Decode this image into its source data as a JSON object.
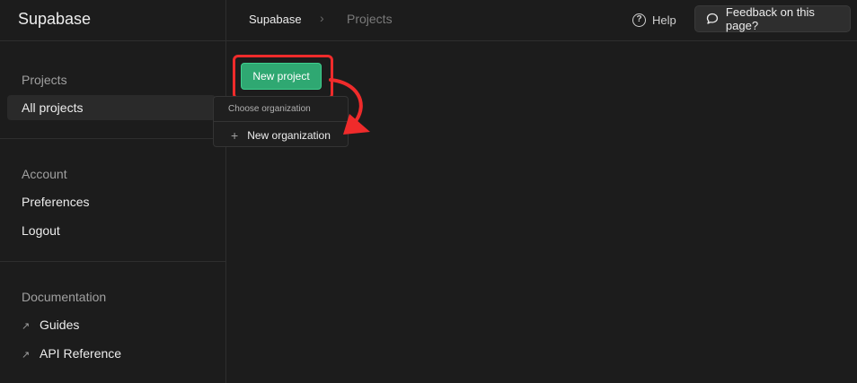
{
  "sidebar": {
    "brand": "Supabase",
    "sections": [
      {
        "title": "Projects",
        "items": [
          {
            "label": "All projects"
          }
        ]
      },
      {
        "title": "Account",
        "items": [
          {
            "label": "Preferences"
          },
          {
            "label": "Logout"
          }
        ]
      },
      {
        "title": "Documentation",
        "items": [
          {
            "label": "Guides"
          },
          {
            "label": "API Reference"
          }
        ]
      }
    ]
  },
  "topbar": {
    "breadcrumb": [
      "Supabase",
      "Projects"
    ],
    "separator": "›",
    "help_label": "Help",
    "feedback_label": "Feedback on this page?"
  },
  "main": {
    "new_project_label": "New project",
    "dropdown": {
      "heading": "Choose organization",
      "item_label": "New organization"
    }
  },
  "colors": {
    "accent": "#3ecf8e",
    "annotation": "#ef2b2b"
  }
}
